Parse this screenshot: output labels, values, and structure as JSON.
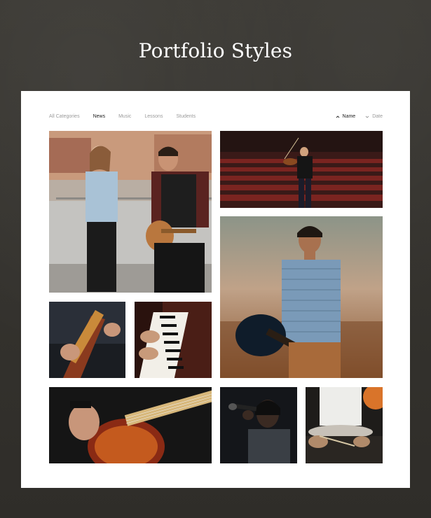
{
  "page": {
    "title": "Portfolio Styles"
  },
  "filters": [
    "All Categories",
    "News",
    "Music",
    "Lessons",
    "Students"
  ],
  "active_filter": "News",
  "sort": [
    {
      "label": "Name",
      "icon": "chevron-up-icon",
      "active": true
    },
    {
      "label": "Date",
      "icon": "chevron-down-icon",
      "active": false
    }
  ],
  "colors": {
    "background": "#34322e",
    "card": "#ffffff",
    "active_text": "#222222",
    "muted_text": "#9a9a9a"
  }
}
